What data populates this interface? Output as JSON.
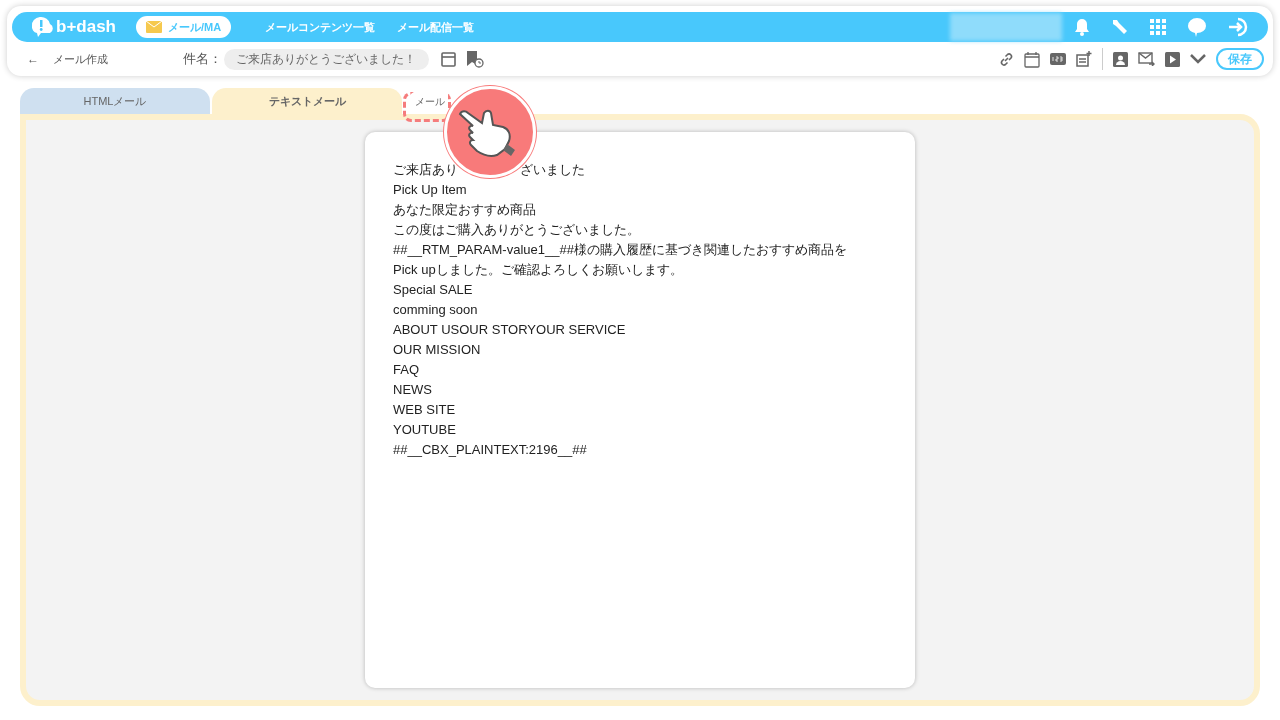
{
  "header": {
    "logo": "b+dash",
    "module": "メール/MA",
    "nav": [
      "メールコンテンツ一覧",
      "メール配信一覧"
    ]
  },
  "toolbar": {
    "back": "←",
    "title": "メール作成",
    "subject_label": "件名：",
    "subject_value": "ご来店ありがとうございました！",
    "save": "保存"
  },
  "tabs": [
    {
      "label": "HTMLメール",
      "selected": false
    },
    {
      "label": "テキストメール",
      "selected": true
    }
  ],
  "format_button": {
    "label": "メール",
    "highlighted": true
  },
  "pointer": {
    "visible": true
  },
  "body_first_line": [
    "ご来店あり",
    "ざいました"
  ],
  "body_lines": [
    "Pick Up Item",
    "あなた限定おすすめ商品",
    "この度はご購入ありがとうございました。",
    "##__RTM_PARAM-value1__##様の購入履歴に基づき関連したおすすめ商品を",
    "Pick upしました。ご確認よろしくお願いします。",
    "Special SALE",
    "comming soon",
    "ABOUT USOUR STORYOUR SERVICE",
    "OUR MISSION",
    "FAQ",
    "NEWS",
    "WEB SITE",
    "YOUTUBE",
    "##__CBX_PLAINTEXT:2196__##"
  ]
}
